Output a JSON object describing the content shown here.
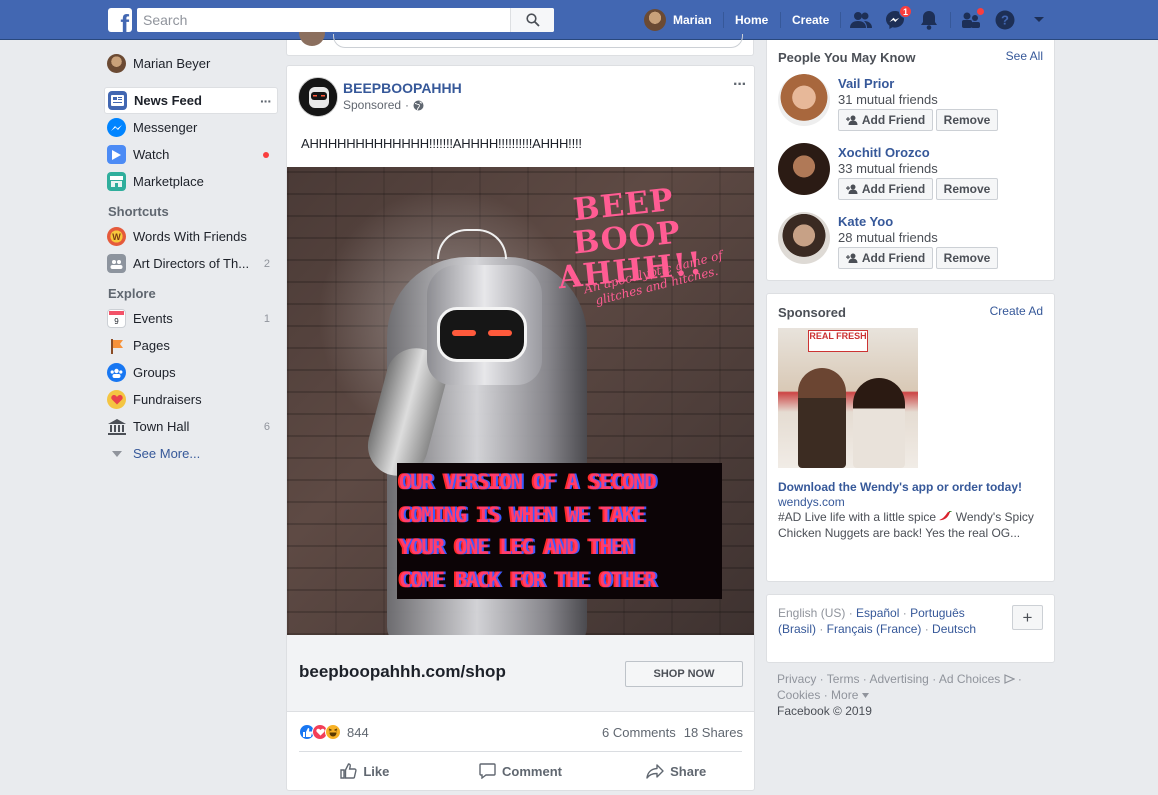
{
  "header": {
    "logo_letter": "f",
    "search_placeholder": "Search",
    "profile_name": "Marian",
    "home_label": "Home",
    "create_label": "Create",
    "messenger_badge": "1",
    "brand_color": "#4267b2"
  },
  "left_nav": {
    "user_name": "Marian Beyer",
    "items": [
      {
        "label": "News Feed",
        "icon": "news-feed-icon",
        "extra": "···"
      },
      {
        "label": "Messenger",
        "icon": "messenger-icon"
      },
      {
        "label": "Watch",
        "icon": "watch-icon"
      },
      {
        "label": "Marketplace",
        "icon": "marketplace-icon"
      }
    ],
    "shortcuts_heading": "Shortcuts",
    "shortcuts": [
      {
        "label": "Words With Friends",
        "count": ""
      },
      {
        "label": "Art Directors of Th...",
        "count": "2"
      }
    ],
    "explore_heading": "Explore",
    "explore": [
      {
        "label": "Events",
        "count": "1"
      },
      {
        "label": "Pages",
        "count": ""
      },
      {
        "label": "Groups",
        "count": ""
      },
      {
        "label": "Fundraisers",
        "count": ""
      },
      {
        "label": "Town Hall",
        "count": "6"
      }
    ],
    "see_more": "See More..."
  },
  "post": {
    "page_name": "BEEPBOOPAHHH",
    "sponsored_label": "Sponsored",
    "menu": "···",
    "text": "AHHHHHHHHHHHHH!!!!!!!AHHHH!!!!!!!!!!AHHH!!!!",
    "image": {
      "title_line1": "BEEP BOOP",
      "title_line2": "AHHH!!",
      "subtitle": "An apocalyptic game of glitches and hitches.",
      "glitch_lines": [
        "OUR VERSION OF A SECOND",
        "COMING IS WHEN WE TAKE",
        "YOUR ONE LEG AND THEN",
        "COME BACK FOR THE OTHER"
      ]
    },
    "link_url": "beepboopahhh.com/shop",
    "cta": "SHOP NOW",
    "reaction_count": "844",
    "comments": "6 Comments",
    "shares": "18 Shares",
    "actions": {
      "like": "Like",
      "comment": "Comment",
      "share": "Share"
    }
  },
  "people_you_may_know": {
    "heading": "People You May Know",
    "see_all": "See All",
    "people": [
      {
        "name": "Vail Prior",
        "mutual": "31 mutual friends"
      },
      {
        "name": "Xochitl Orozco",
        "mutual": "33 mutual friends"
      },
      {
        "name": "Kate Yoo",
        "mutual": "28 mutual friends"
      }
    ],
    "add_label": "Add Friend",
    "remove_label": "Remove"
  },
  "sponsored_ad": {
    "heading": "Sponsored",
    "create_ad": "Create Ad",
    "image_sign": "REAL FRESH",
    "title": "Download the Wendy's app or order today!",
    "domain": "wendys.com",
    "body_1": "#AD Live life with a little spice",
    "body_2": "Wendy's Spicy Chicken Nuggets are back! Yes the real OG..."
  },
  "languages": {
    "current": "English (US)",
    "others": [
      "Español",
      "Português (Brasil)",
      "Français (France)",
      "Deutsch"
    ],
    "plus": "+"
  },
  "footer": {
    "links": [
      "Privacy",
      "Terms",
      "Advertising",
      "Ad Choices",
      "Cookies",
      "More"
    ],
    "copyright": "Facebook © 2019"
  }
}
